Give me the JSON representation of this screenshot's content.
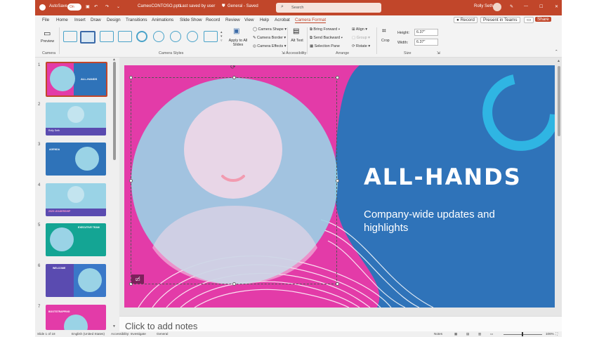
{
  "window": {
    "autosave": "AutoSave",
    "toggle": "On",
    "filename": "CameoCONTOSO.pptx",
    "saved_info": "Last saved by user",
    "sensitivity": "General - Saved",
    "search_placeholder": "Search",
    "user": "Rolly Seth"
  },
  "tabs": [
    "File",
    "Home",
    "Insert",
    "Draw",
    "Design",
    "Transitions",
    "Animations",
    "Slide Show",
    "Record",
    "Review",
    "View",
    "Help",
    "Acrobat",
    "Camera Format"
  ],
  "actions": {
    "record": "Record",
    "present": "Present in Teams",
    "share": "Share"
  },
  "ribbon": {
    "preview": "Preview",
    "camera": "Camera",
    "camera_styles": "Camera Styles",
    "apply_all": "Apply to All Slides",
    "camera_shape": "Camera Shape",
    "camera_border": "Camera Border",
    "camera_effects": "Camera Effects",
    "alt_text": "Alt Text",
    "accessibility": "Accessibility",
    "bring_forward": "Bring Forward",
    "send_backward": "Send Backward",
    "selection_pane": "Selection Pane",
    "align": "Align",
    "group": "Group",
    "rotate": "Rotate",
    "arrange": "Arrange",
    "crop": "Crop",
    "height_label": "Height:",
    "height": "6.37\"",
    "width_label": "Width:",
    "width": "6.37\"",
    "size": "Size"
  },
  "thumbnails": [
    {
      "num": "1",
      "title": "ALL-HANDS"
    },
    {
      "num": "2",
      "title": "Rolly Seth"
    },
    {
      "num": "3",
      "title": "AGENDA"
    },
    {
      "num": "4",
      "title": "2025 LEADERSHIP"
    },
    {
      "num": "5",
      "title": "EXECUTIVE TEAM"
    },
    {
      "num": "6",
      "title": "WELCOME"
    },
    {
      "num": "7",
      "title": "BOOTSTRAPPING"
    }
  ],
  "slide": {
    "title": "ALL-HANDS",
    "subtitle_line1": "Company-wide updates and",
    "subtitle_line2": "highlights"
  },
  "notes_placeholder": "Click to add notes",
  "status": {
    "slide": "Slide 1 of 18",
    "language": "English (United States)",
    "accessibility": "Accessibility: Investigate",
    "general": "General",
    "notes": "Notes",
    "zoom": "106%"
  },
  "colors": {
    "accent": "#c1462a",
    "slide_pink": "#e33ba8",
    "slide_blue": "#2f73b9",
    "camera_tint": "#9ad3e6"
  }
}
